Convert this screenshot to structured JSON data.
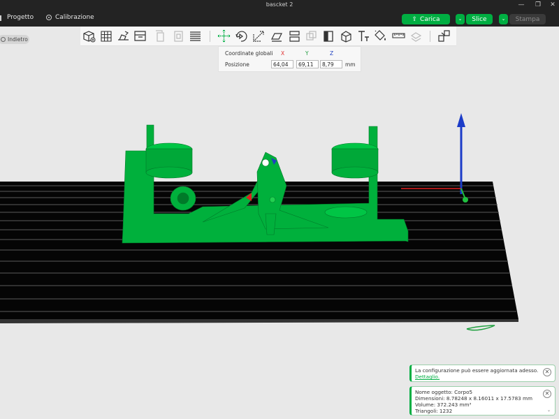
{
  "window": {
    "title": "bascket 2"
  },
  "menu": {
    "project": "Progetto",
    "calibration": "Calibrazione"
  },
  "window_controls": {
    "minimize": "—",
    "restore": "❐",
    "close": "✕"
  },
  "actions": {
    "upload": "Carica",
    "slice": "Slice",
    "print": "Stampa"
  },
  "toolbar": {
    "icons": [
      "add-object-icon",
      "grid-arrange-icon",
      "orient-icon",
      "plate-settings-icon",
      "copy-disabled-icon",
      "paste-disabled-icon",
      "layers-icon",
      "move-icon",
      "rotate-icon",
      "scale-icon",
      "lay-on-face-icon",
      "cut-icon",
      "boolean-disabled-icon",
      "support-paint-icon",
      "seam-paint-icon",
      "text-icon",
      "color-paint-icon",
      "measure-icon",
      "assembly-disabled-icon",
      "view-explode-icon"
    ]
  },
  "back_button": {
    "label": "Indietro"
  },
  "coordinates": {
    "header": "Coordinate globali",
    "axis_x": "X",
    "axis_y": "Y",
    "axis_z": "Z",
    "position_label": "Posizione",
    "x": "64,04",
    "y": "69,11",
    "z": "8,79",
    "unit": "mm"
  },
  "colors": {
    "accent": "#00ae42",
    "model": "#00b03c",
    "bed": "#050505"
  },
  "notifications": [
    {
      "text": "La configurazione può essere aggiornata adesso.",
      "link": "Dettaglio."
    },
    {
      "name": "Nome oggetto: Corpo5",
      "dimensions": "Dimensioni: 8.78248 x 8.16011 x 17.5783 mm",
      "volume": "Volume: 372.243 mm³",
      "triangles": "Triangoli: 1232"
    }
  ]
}
